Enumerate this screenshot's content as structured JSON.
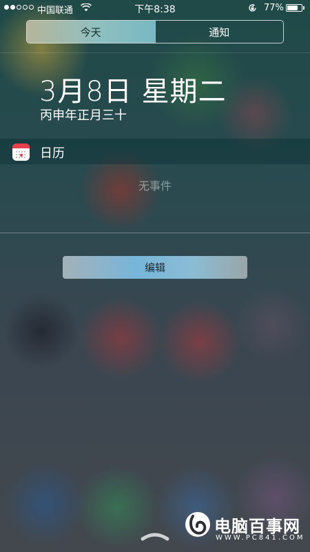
{
  "status_bar": {
    "signal_bars_total": 5,
    "signal_bars_filled": 2,
    "carrier": "中国联通",
    "wifi_icon": "wifi-icon",
    "time": "下午8:38",
    "rotation_lock_icon": "rotation-lock-icon",
    "battery_percent_text": "77%",
    "battery_level": 0.77
  },
  "segmented_control": {
    "tabs": [
      {
        "label": "今天",
        "selected": true
      },
      {
        "label": "通知",
        "selected": false
      }
    ]
  },
  "today": {
    "date": "3月8日 星期二",
    "lunar_date": "丙申年正月三十"
  },
  "calendar_widget": {
    "icon": "calendar-icon",
    "title": "日历",
    "empty_text": "无事件"
  },
  "edit_button": {
    "label": "编辑"
  },
  "watermark": {
    "name": "电脑百事网",
    "url": "WWW.PC841.COM"
  },
  "colors": {
    "calendar_red": "#e8404a",
    "segment_active": "#8fc0c0",
    "edit_button": "#77b5da"
  }
}
